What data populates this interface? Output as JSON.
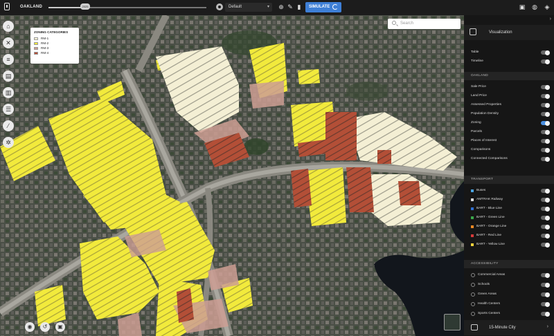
{
  "app": {
    "title": "OAKLAND"
  },
  "timeline": {
    "handle_label": "2025"
  },
  "toolbar": {
    "preset": "Default",
    "simulate_label": "SIMULATE",
    "icons": [
      "radio-icon",
      "add-icon",
      "pencil-icon",
      "trash-icon",
      "save-icon",
      "globe-icon",
      "layers-icon"
    ]
  },
  "search": {
    "placeholder": "Search"
  },
  "legend": {
    "title": "ZONING CATEGORIES",
    "items": [
      {
        "label": "RM-1",
        "color": "#f7f3d6"
      },
      {
        "label": "RM-2",
        "color": "#f2ea3c"
      },
      {
        "label": "RM-3",
        "color": "#cc9e93"
      },
      {
        "label": "RM-4",
        "color": "#b34f37"
      }
    ]
  },
  "left_tools": [
    "home-icon",
    "tools-icon",
    "layers-icon",
    "document-icon",
    "building-icon",
    "database-icon",
    "brush-icon",
    "settings-icon"
  ],
  "bottom_tools": [
    "camera-icon",
    "history-icon",
    "screenshot-icon"
  ],
  "panel": {
    "title": "Visualization",
    "top_rows": [
      {
        "label": "Table",
        "on": false
      },
      {
        "label": "Timeline",
        "on": false
      }
    ],
    "oakland": {
      "header": "OAKLAND",
      "rows": [
        {
          "label": "Sale Price",
          "on": false
        },
        {
          "label": "Land Price",
          "on": false
        },
        {
          "label": "Assessed Properties",
          "on": false
        },
        {
          "label": "Population Density",
          "on": false
        },
        {
          "label": "Zoning",
          "on": true
        },
        {
          "label": "Parcels",
          "on": false
        },
        {
          "label": "Places of Interest",
          "on": false
        },
        {
          "label": "Comparisons",
          "on": false
        },
        {
          "label": "Connected Comparisons",
          "on": false
        }
      ]
    },
    "transport": {
      "header": "TRANSPORT",
      "rows": [
        {
          "label": "Buses",
          "color": "#4aa3df",
          "on": false
        },
        {
          "label": "AMTRAK Railway",
          "color": "#dddddd",
          "on": false
        },
        {
          "label": "BART - Blue Line",
          "color": "#2f6fd0",
          "on": false
        },
        {
          "label": "BART - Green Line",
          "color": "#3aa84a",
          "on": false
        },
        {
          "label": "BART - Orange Line",
          "color": "#f08a24",
          "on": false
        },
        {
          "label": "BART - Red Line",
          "color": "#d93a3a",
          "on": false
        },
        {
          "label": "BART - Yellow Line",
          "color": "#f2d23c",
          "on": false
        }
      ]
    },
    "accessibility": {
      "header": "ACCESSIBILITY",
      "rows": [
        {
          "label": "Commercial Areas",
          "on": false
        },
        {
          "label": "Schools",
          "on": false
        },
        {
          "label": "Green Areas",
          "on": false
        },
        {
          "label": "Health Centers",
          "on": false
        },
        {
          "label": "Sports Centers",
          "on": false
        }
      ]
    },
    "footer": "15-Minute City"
  }
}
